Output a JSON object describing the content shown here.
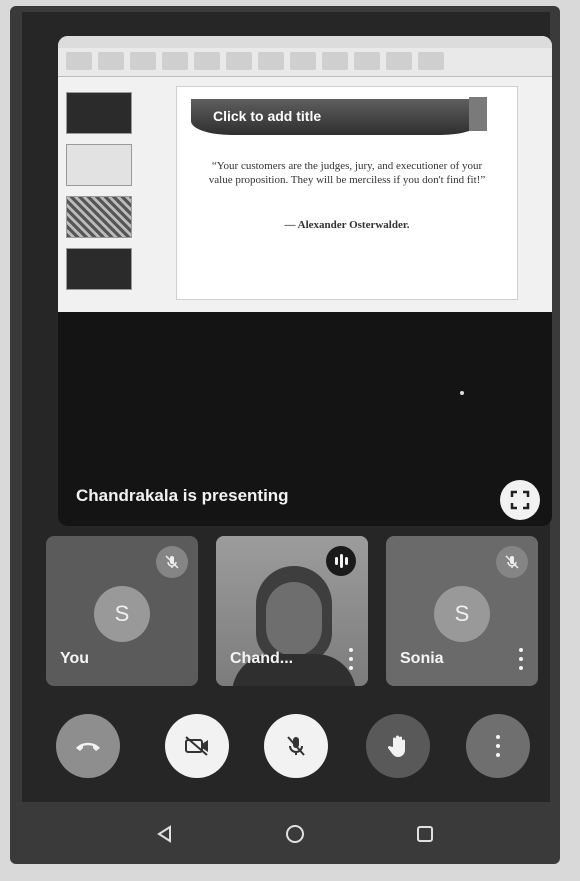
{
  "slide": {
    "title": "Click to add title",
    "quote": "“Your customers are the judges, jury, and executioner of your value proposition. They will be merciless if you don't find fit!”",
    "author": "— Alexander Osterwalder."
  },
  "presentation": {
    "status": "Chandrakala is presenting"
  },
  "participants": [
    {
      "name": "You",
      "initial": "S",
      "muted": true
    },
    {
      "name": "Chand...",
      "speaking": true
    },
    {
      "name": "Sonia",
      "initial": "S",
      "muted": true
    }
  ],
  "controls": [
    "hang-up",
    "camera-off",
    "mic-off",
    "raise-hand",
    "more-options"
  ],
  "navigation": [
    "back",
    "home",
    "recents"
  ],
  "colors": {
    "background": "#262626",
    "tile": "#5b5b5b",
    "button_light": "#f2f2f2"
  }
}
